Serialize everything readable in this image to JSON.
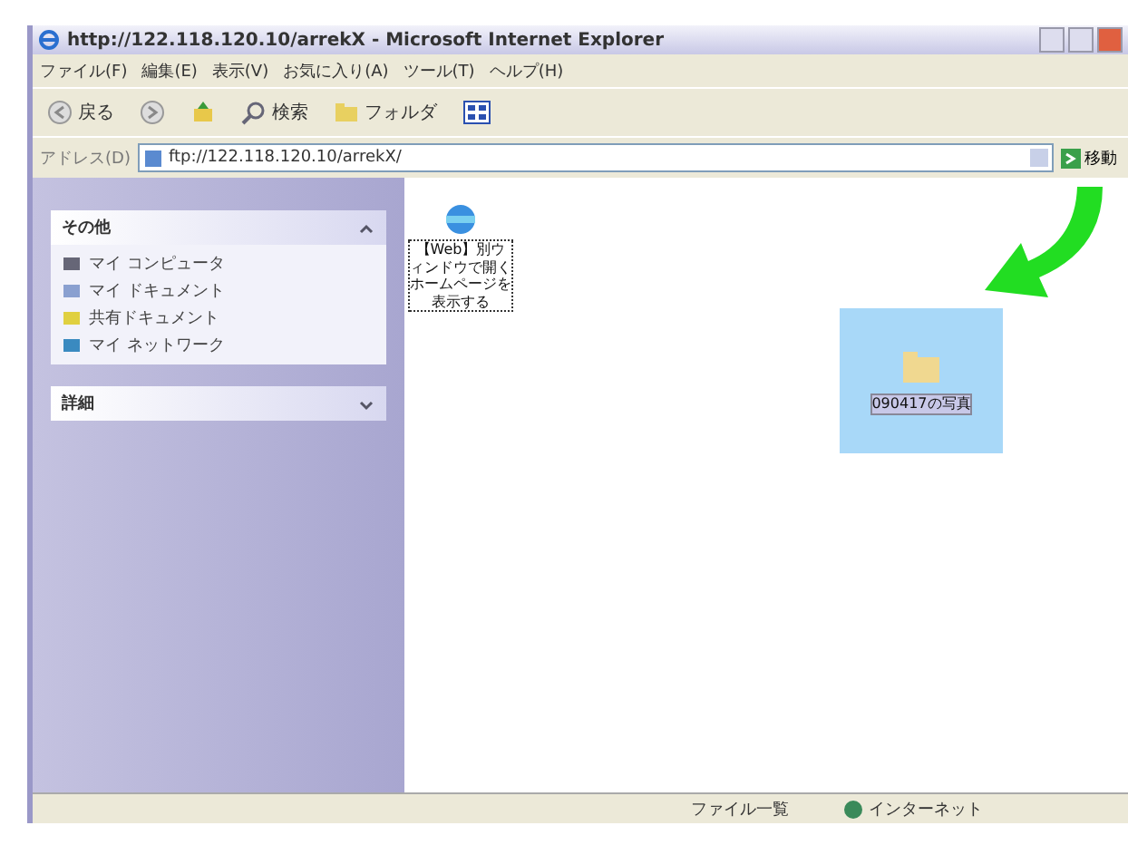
{
  "window": {
    "title": "http://122.118.120.10/arrekX - Microsoft Internet Explorer"
  },
  "menu": [
    "ファイル(F)",
    "編集(E)",
    "表示(V)",
    "お気に入り(A)",
    "ツール(T)",
    "ヘルプ(H)"
  ],
  "toolbar": [
    {
      "kind": "back",
      "label": "戻る"
    },
    {
      "kind": "forward"
    },
    {
      "kind": "up"
    },
    {
      "kind": "search",
      "label": "検索"
    },
    {
      "kind": "folders",
      "label": "フォルダ"
    },
    {
      "kind": "views"
    }
  ],
  "address": {
    "label": "アドレス(D)",
    "value": "ftp://122.118.120.10/arrekX/",
    "go": "移動"
  },
  "sidebar": {
    "panels": [
      {
        "title": "その他",
        "expanded": true,
        "items": [
          {
            "kind": "computer",
            "label": "マイ コンピュータ"
          },
          {
            "kind": "documents",
            "label": "マイ ドキュメント"
          },
          {
            "kind": "shared",
            "label": "共有ドキュメント"
          },
          {
            "kind": "network",
            "label": "マイ ネットワーク"
          }
        ]
      },
      {
        "title": "詳細",
        "expanded": false
      }
    ]
  },
  "files": [
    {
      "kind": "shortcut",
      "label": "【Web】別ウィンドウで開くホームページを表示する",
      "selected": false
    },
    {
      "kind": "folder",
      "label": "090417の写真",
      "selected": true
    }
  ],
  "status_bar": {
    "zone_prefix": "ファイル一覧",
    "zone": "インターネット"
  }
}
